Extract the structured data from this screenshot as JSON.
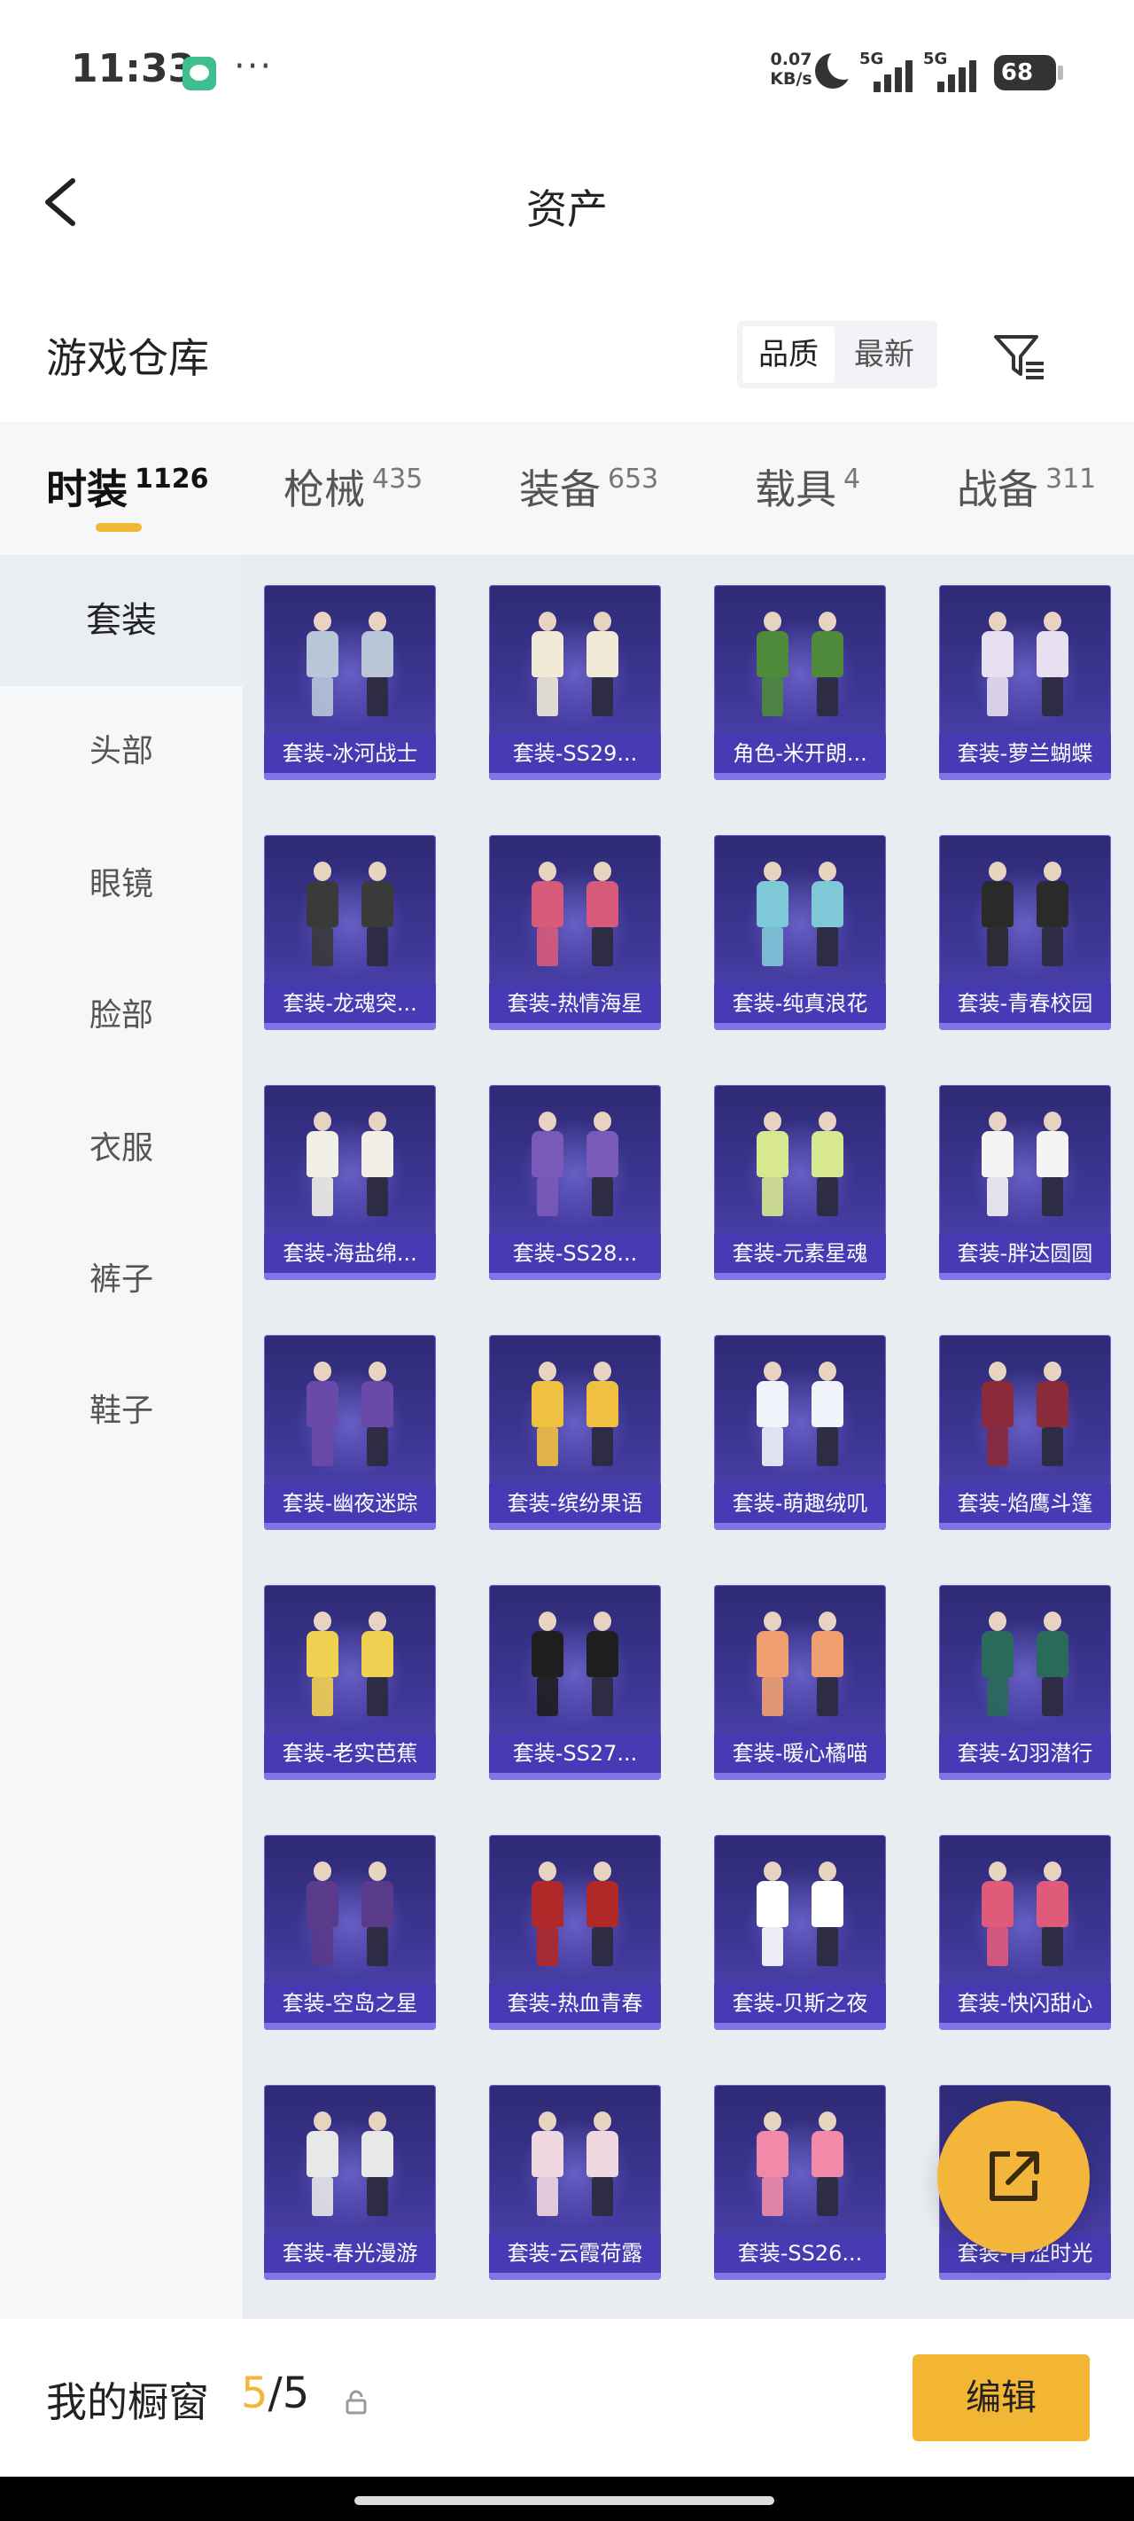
{
  "status_bar": {
    "time": "11:33",
    "net_speed_value": "0.07",
    "net_speed_unit": "KB/s",
    "sim1": "5G",
    "sim2": "5G",
    "battery": "68"
  },
  "header": {
    "title": "资产"
  },
  "warehouse": {
    "title": "游戏仓库",
    "sort_options": [
      "品质",
      "最新"
    ],
    "active_sort": "品质"
  },
  "tabs": [
    {
      "name": "时装",
      "count": "1126"
    },
    {
      "name": "枪械",
      "count": "435"
    },
    {
      "name": "装备",
      "count": "653"
    },
    {
      "name": "载具",
      "count": "4"
    },
    {
      "name": "战备",
      "count": "311"
    }
  ],
  "sidebar": {
    "items": [
      "套装",
      "头部",
      "眼镜",
      "脸部",
      "衣服",
      "裤子",
      "鞋子"
    ],
    "active": "套装"
  },
  "items": [
    "套装-冰河战士",
    "套装-SS29...",
    "角色-米开朗...",
    "套装-萝兰蝴蝶",
    "套装-龙魂突...",
    "套装-热情海星",
    "套装-纯真浪花",
    "套装-青春校园",
    "套装-海盐绵...",
    "套装-SS28...",
    "套装-元素星魂",
    "套装-胖达圆圆",
    "套装-幽夜迷踪",
    "套装-缤纷果语",
    "套装-萌趣绒叽",
    "套装-焰鹰斗篷",
    "套装-老实芭蕉",
    "套装-SS27...",
    "套装-暖心橘喵",
    "套装-幻羽潜行",
    "套装-空岛之星",
    "套装-热血青春",
    "套装-贝斯之夜",
    "套装-快闪甜心",
    "套装-春光漫游",
    "套装-云霞荷露",
    "套装-SS26...",
    "套装-青涩时光"
  ],
  "item_icon_colors": [
    "#b8c6d8",
    "#f0ead6",
    "#4e8a3a",
    "#e8e0f0",
    "#3a3a3a",
    "#d85a7a",
    "#7fc8d8",
    "#2a2a2a",
    "#f2efe6",
    "#7a5ab8",
    "#d8e890",
    "#f4f4f4",
    "#6a4aa8",
    "#f0c040",
    "#f0f4fa",
    "#8a2a3a",
    "#f0d050",
    "#1e1e1e",
    "#f0a070",
    "#2a6a5a",
    "#5a3a8a",
    "#b02828",
    "#ffffff",
    "#e05a7a",
    "#e8e8e8",
    "#f0d8e0",
    "#f08aa8",
    "#d8b0c0"
  ],
  "showcase": {
    "label": "我的橱窗",
    "current": "5",
    "total": "5",
    "edit_label": "编辑"
  },
  "accent_color": "#f3b633",
  "icons": [
    "back-arrow-icon",
    "filter-icon",
    "share-icon",
    "lock-icon",
    "wechat-icon",
    "moon-icon",
    "signal-icon",
    "battery-icon"
  ]
}
